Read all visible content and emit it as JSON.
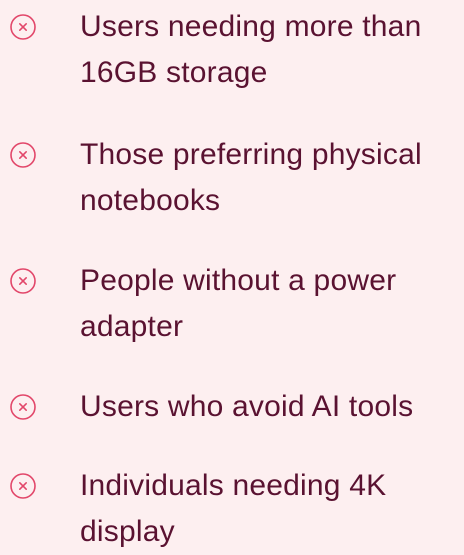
{
  "list": {
    "items": [
      {
        "icon": "close-circle-icon",
        "label": "Users needing more than 16GB storage"
      },
      {
        "icon": "close-circle-icon",
        "label": "Those preferring physical notebooks"
      },
      {
        "icon": "close-circle-icon",
        "label": "People without a power adapter"
      },
      {
        "icon": "close-circle-icon",
        "label": "Users who avoid AI tools"
      },
      {
        "icon": "close-circle-icon",
        "label": "Individuals needing 4K display"
      }
    ]
  },
  "colors": {
    "background": "#FDEFF0",
    "text": "#5A1231",
    "icon": "#E2476A"
  }
}
